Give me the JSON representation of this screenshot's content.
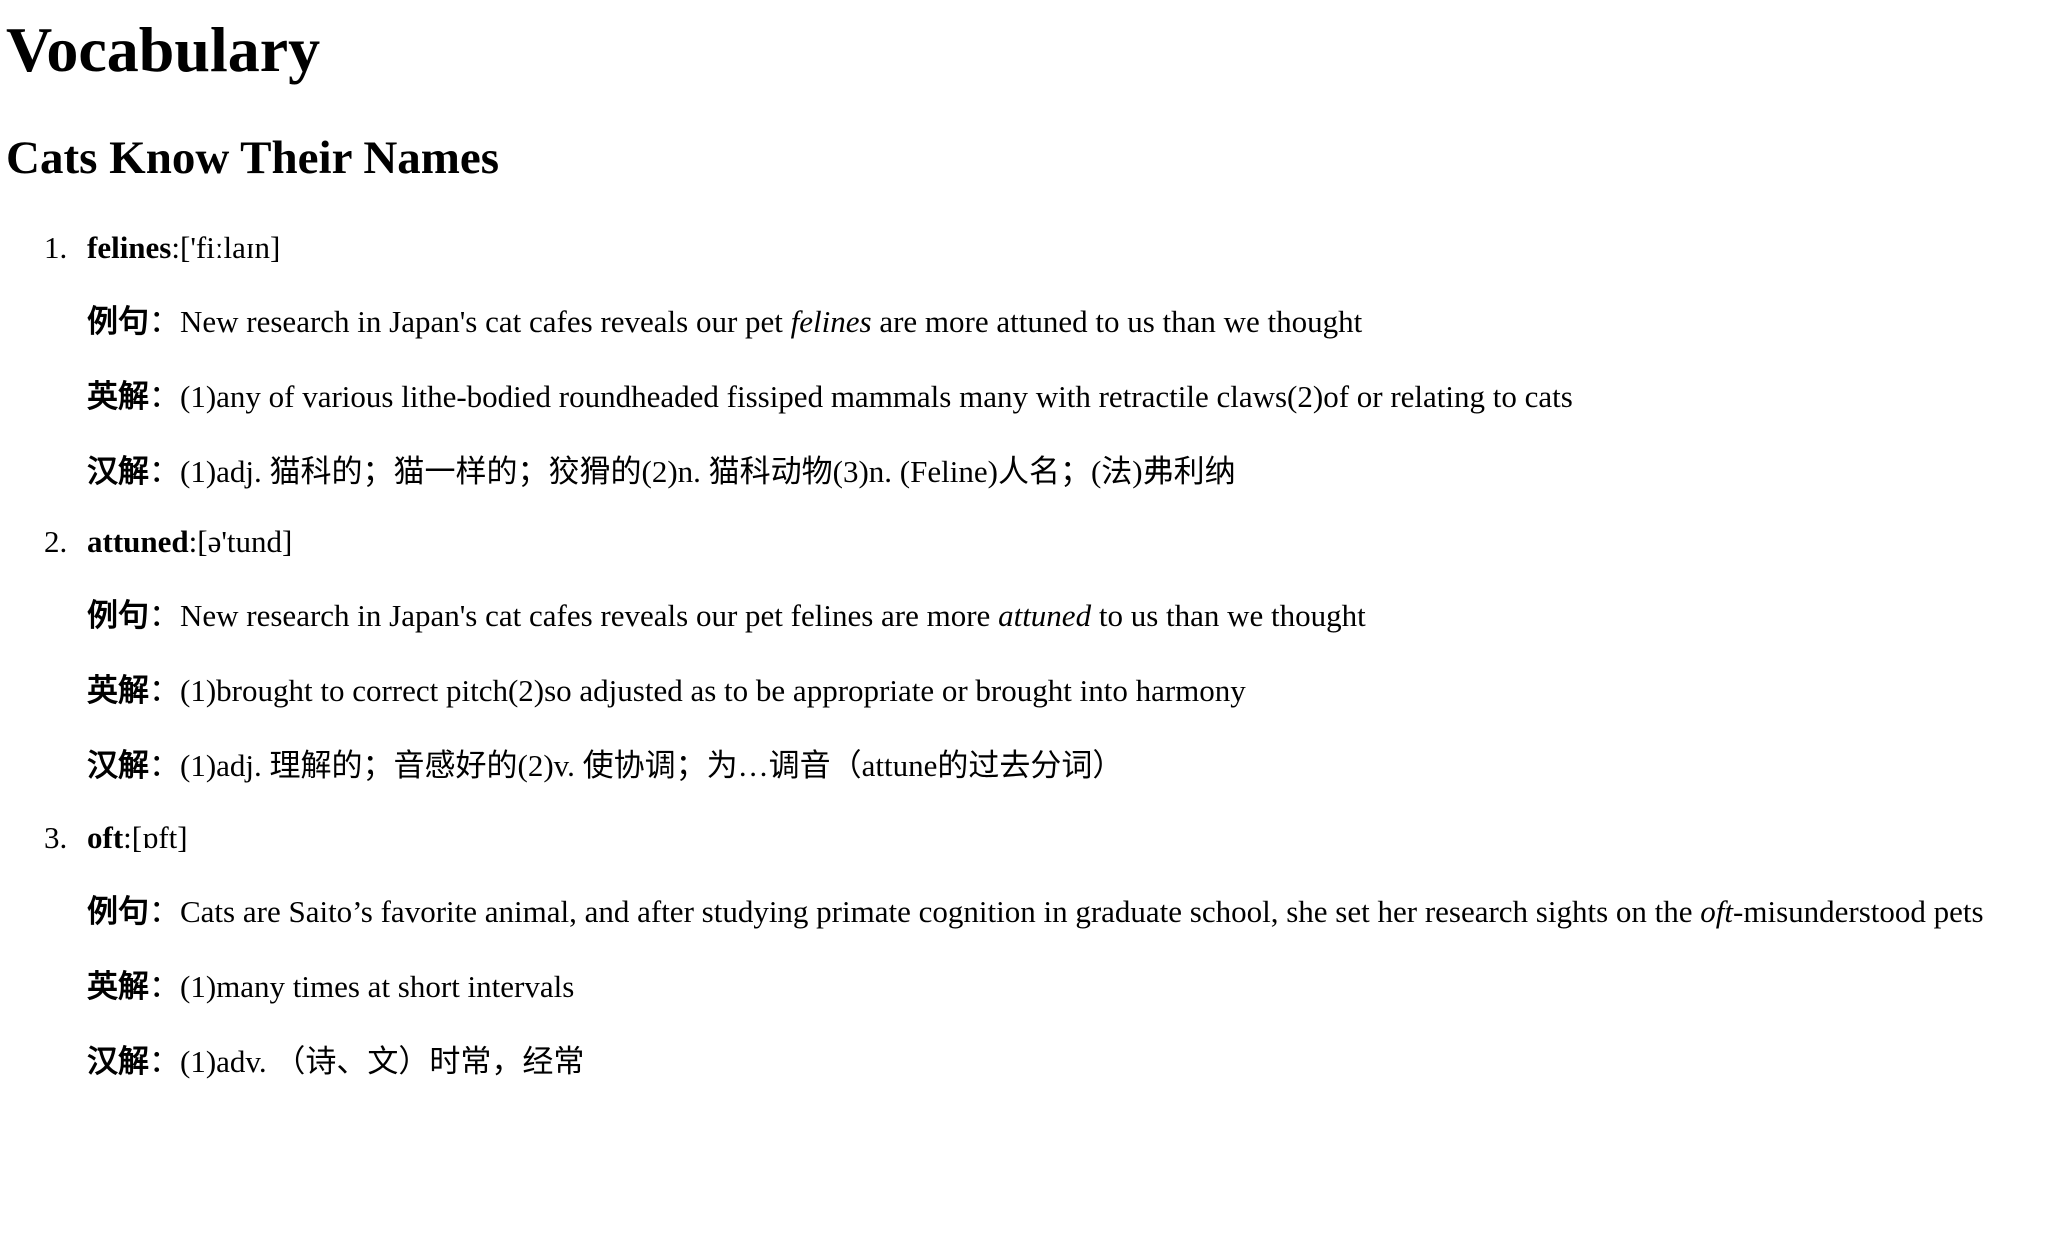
{
  "title": "Vocabulary",
  "subtitle": "Cats Know Their Names",
  "labels": {
    "example": "例句",
    "english": "英解",
    "chinese": "汉解",
    "colon": ":"
  },
  "entries": [
    {
      "number": "1.",
      "word": "felines",
      "phonetic": "['fiːlaɪn]",
      "example_before": "New research in Japan's cat cafes reveals our pet ",
      "example_keyword": "felines",
      "example_after": " are more attuned to us than we thought",
      "english": "(1)any of various lithe-bodied roundheaded fissiped mammals many with retractile claws(2)of or relating to cats",
      "chinese": "(1)adj. 猫科的；猫一样的；狡猾的(2)n. 猫科动物(3)n. (Feline)人名；(法)弗利纳"
    },
    {
      "number": "2.",
      "word": "attuned",
      "phonetic": "[ə'tund]",
      "example_before": "New research in Japan's cat cafes reveals our pet felines are more ",
      "example_keyword": "attuned",
      "example_after": " to us than we thought",
      "english": "(1)brought to correct pitch(2)so adjusted as to be appropriate or brought into harmony",
      "chinese": "(1)adj. 理解的；音感好的(2)v. 使协调；为…调音（attune的过去分词）"
    },
    {
      "number": "3.",
      "word": "oft",
      "phonetic": "[ɒft]",
      "example_before": "Cats are Saito’s favorite animal, and after studying primate cognition in graduate school, she set her research sights on the ",
      "example_keyword": "oft",
      "example_after": "-misunderstood pets",
      "english": "(1)many times at short intervals",
      "chinese": "(1)adv. （诗、文）时常，经常"
    }
  ]
}
